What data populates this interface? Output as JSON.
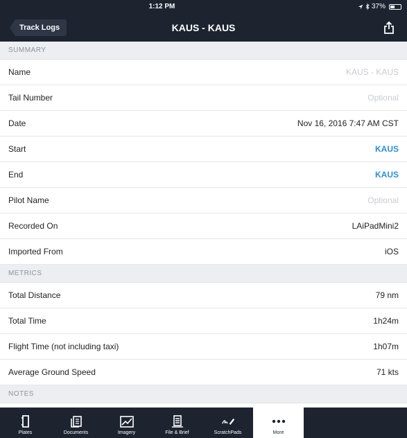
{
  "status_bar": {
    "time": "1:12 PM",
    "battery_text": "37%",
    "battery_level": 0.37
  },
  "nav": {
    "back_label": "Track Logs",
    "title": "KAUS - KAUS"
  },
  "sections": [
    {
      "header": "SUMMARY",
      "rows": [
        {
          "label": "Name",
          "value": "KAUS - KAUS",
          "style": "placeholder"
        },
        {
          "label": "Tail Number",
          "value": "Optional",
          "style": "placeholder"
        },
        {
          "label": "Date",
          "value": "Nov 16, 2016 7:47 AM CST",
          "style": "normal"
        },
        {
          "label": "Start",
          "value": "KAUS",
          "style": "link"
        },
        {
          "label": "End",
          "value": "KAUS",
          "style": "link"
        },
        {
          "label": "Pilot Name",
          "value": "Optional",
          "style": "placeholder"
        },
        {
          "label": "Recorded On",
          "value": "LAiPadMini2",
          "style": "normal"
        },
        {
          "label": "Imported From",
          "value": "iOS",
          "style": "normal"
        }
      ]
    },
    {
      "header": "METRICS",
      "rows": [
        {
          "label": "Total Distance",
          "value": "79 nm",
          "style": "normal"
        },
        {
          "label": "Total Time",
          "value": "1h24m",
          "style": "normal"
        },
        {
          "label": "Flight Time (not including taxi)",
          "value": "1h07m",
          "style": "normal"
        },
        {
          "label": "Average Ground Speed",
          "value": "71 kts",
          "style": "normal"
        }
      ]
    },
    {
      "header": "NOTES",
      "rows": []
    }
  ],
  "tabs": [
    {
      "label": "Plates",
      "icon": "plates-icon"
    },
    {
      "label": "Documents",
      "icon": "documents-icon"
    },
    {
      "label": "Imagery",
      "icon": "imagery-icon"
    },
    {
      "label": "File & Brief",
      "icon": "file-brief-icon"
    },
    {
      "label": "ScratchPads",
      "icon": "scratchpads-icon"
    },
    {
      "label": "More",
      "icon": "more-icon",
      "selected": true
    }
  ],
  "colors": {
    "bar": "#1d2430",
    "link": "#2d8fd5",
    "section_bg": "#eceef1"
  }
}
